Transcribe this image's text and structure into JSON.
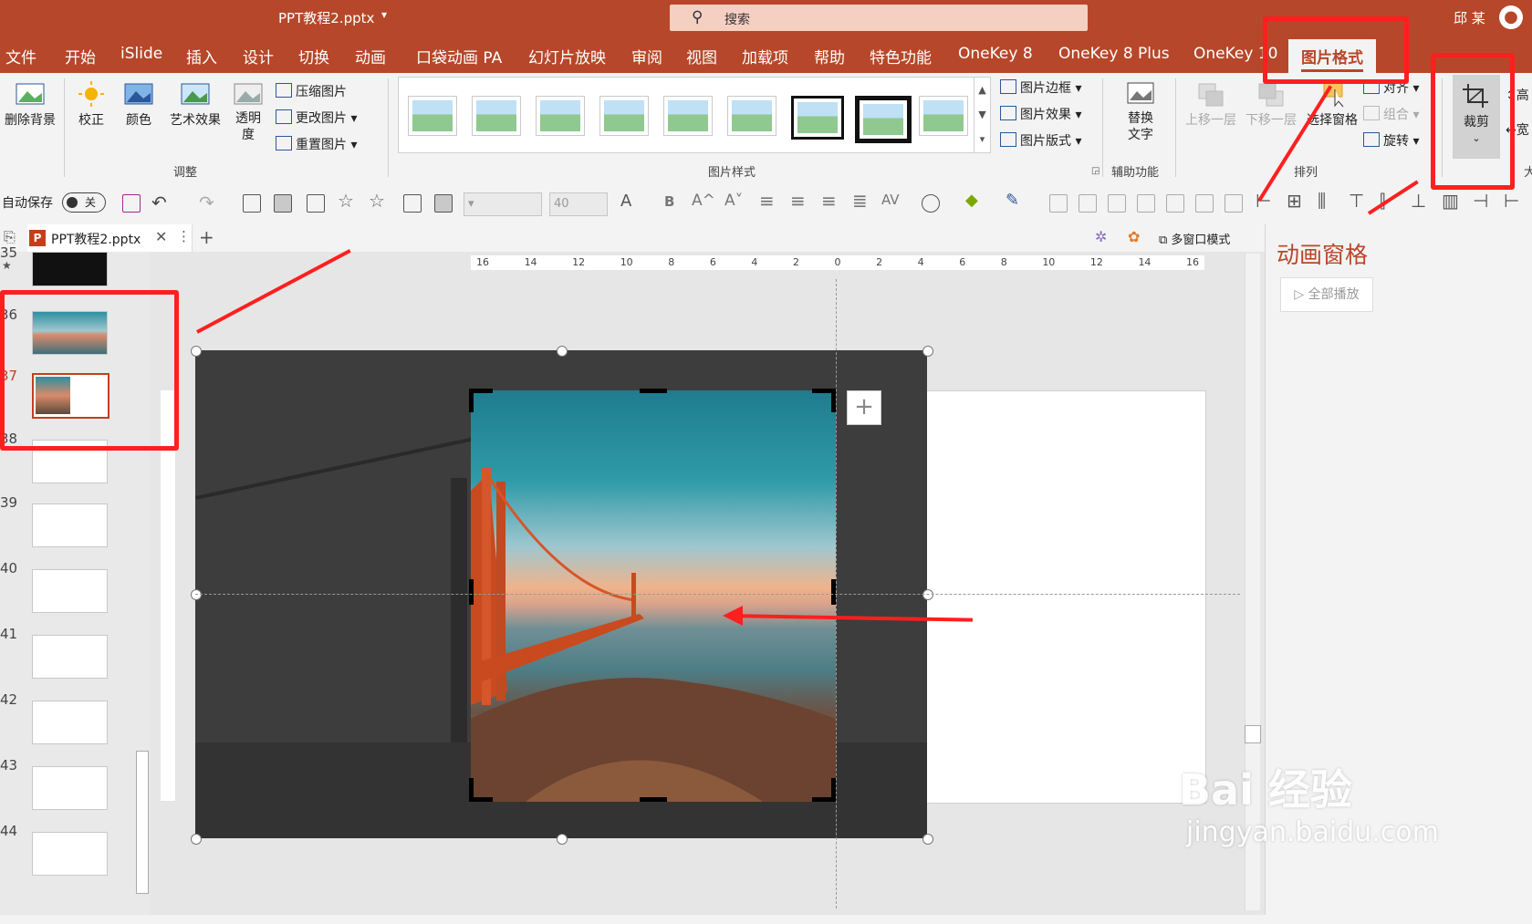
{
  "titlebar": {
    "filename": "PPT教程2.pptx",
    "search_placeholder": "搜索",
    "user": "邱 某"
  },
  "tabs": [
    "文件",
    "开始",
    "iSlide",
    "插入",
    "设计",
    "切换",
    "动画",
    "口袋动画 PA",
    "幻灯片放映",
    "审阅",
    "视图",
    "加载项",
    "帮助",
    "特色功能",
    "OneKey 8",
    "OneKey 8 Plus",
    "OneKey 10",
    "图片格式"
  ],
  "ribbon": {
    "remove_bg": "删除背景",
    "correct": "校正",
    "color": "颜色",
    "art_effect": "艺术效果",
    "transparency": "透明度",
    "compress": "压缩图片",
    "change": "更改图片",
    "reset": "重置图片",
    "group_adjust": "调整",
    "group_styles": "图片样式",
    "border": "图片边框",
    "effects": "图片效果",
    "layout": "图片版式",
    "alt_text": "替换文字",
    "group_access": "辅助功能",
    "bring_forward": "上移一层",
    "send_backward": "下移一层",
    "selection_pane": "选择窗格",
    "align": "对齐",
    "group": "组合",
    "rotate": "旋转",
    "group_arrange": "排列",
    "crop": "裁剪",
    "height": "高",
    "width": "宽",
    "size_label": "大"
  },
  "qat": {
    "autosave": "自动保存",
    "toggle": "关",
    "font_size": "40"
  },
  "doc": {
    "tab": "PPT教程2.pptx",
    "multi_window": "多窗口模式"
  },
  "slides": [
    "35",
    "36",
    "37",
    "38",
    "39",
    "40",
    "41",
    "42",
    "43",
    "44"
  ],
  "ruler": [
    "16",
    "14",
    "12",
    "10",
    "8",
    "6",
    "4",
    "2",
    "0",
    "2",
    "4",
    "6",
    "8",
    "10",
    "12",
    "14",
    "16"
  ],
  "anim": {
    "title": "动画窗格",
    "play_all": "全部播放"
  },
  "watermark": {
    "logo": "Bai 经验",
    "url": "jingyan.baidu.com"
  },
  "colors": {
    "accent": "#b7472a",
    "annotation": "#ff1f1f"
  }
}
